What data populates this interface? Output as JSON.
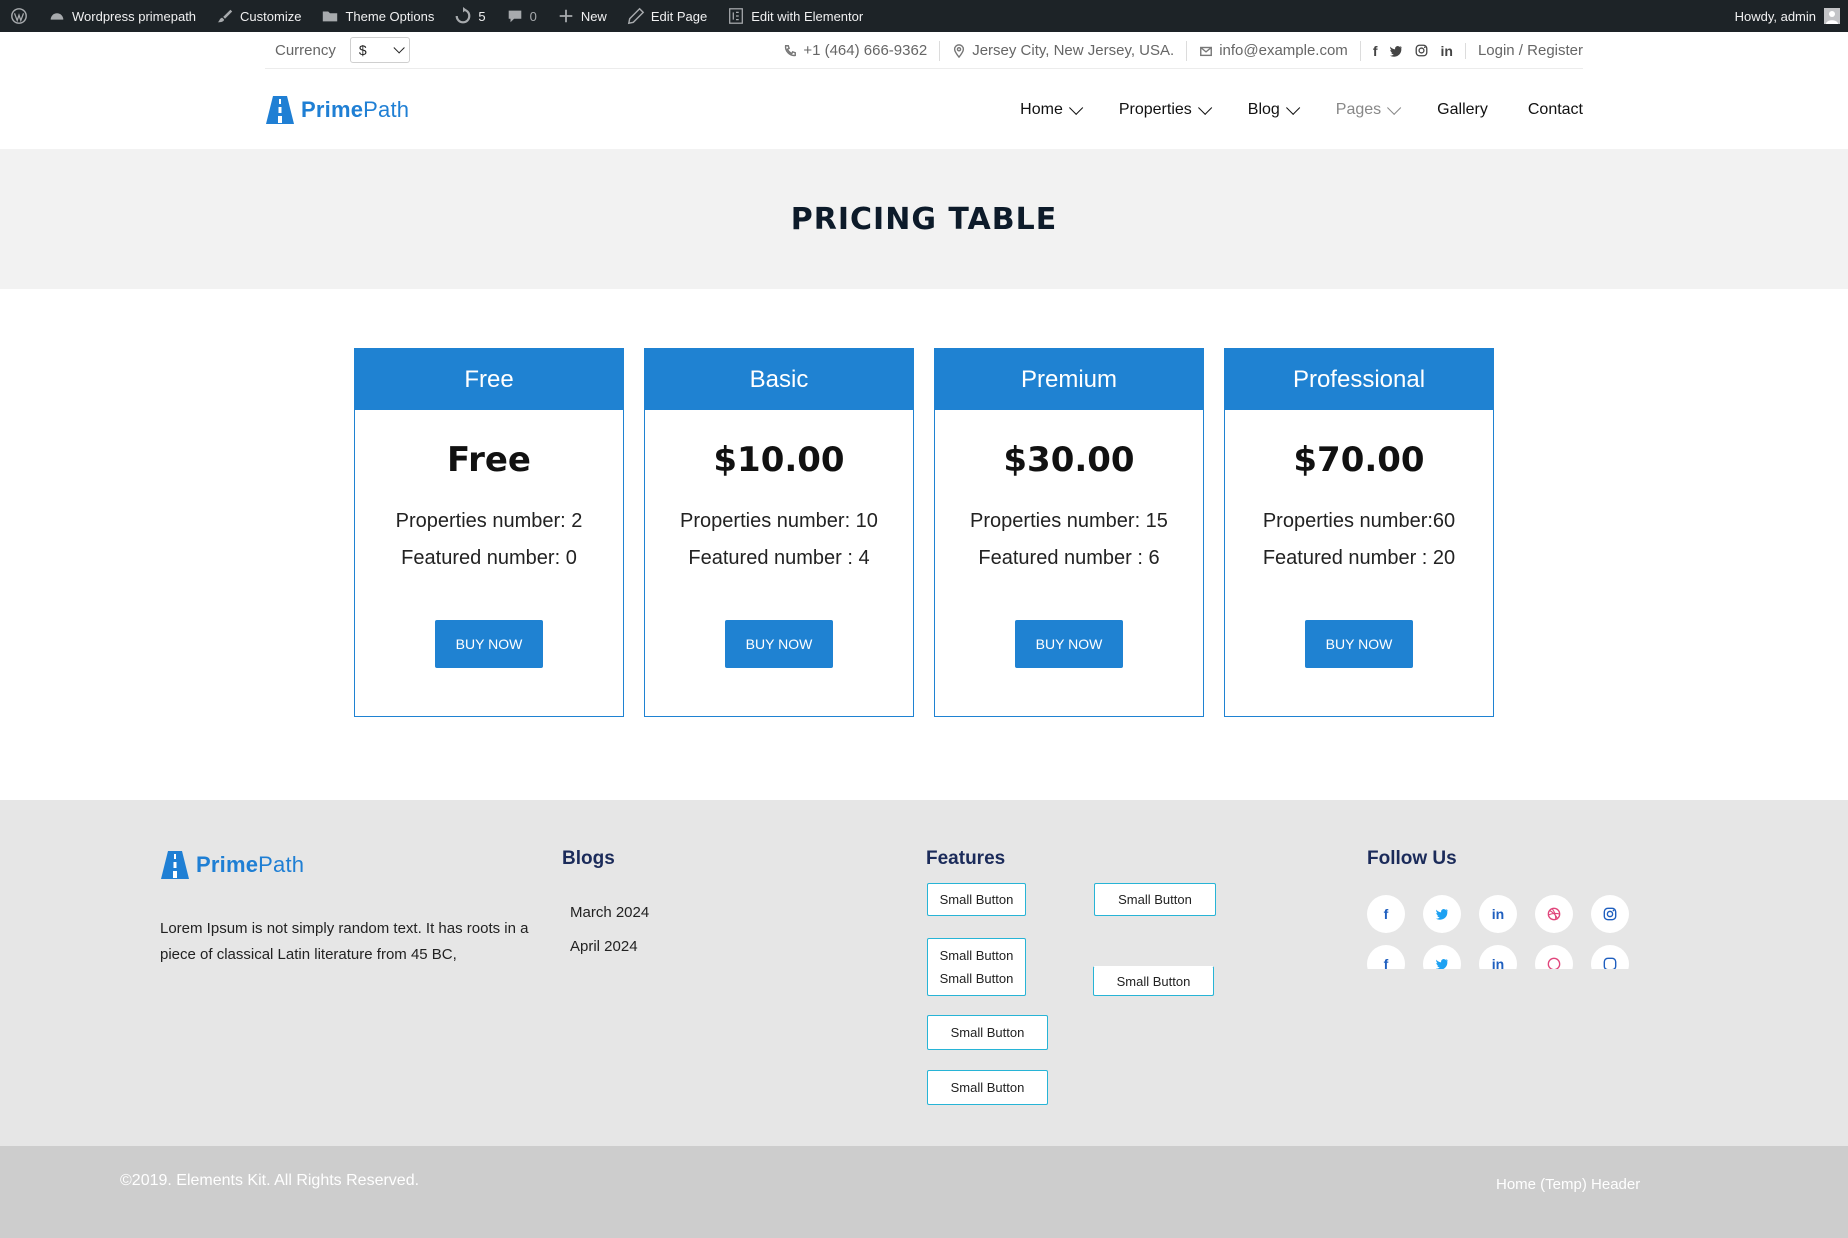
{
  "adminbar": {
    "site_name": "Wordpress primepath",
    "customize": "Customize",
    "theme_options": "Theme Options",
    "updates": "5",
    "comments": "0",
    "new": "New",
    "edit_page": "Edit Page",
    "edit_elementor": "Edit with Elementor",
    "howdy": "Howdy, admin"
  },
  "topbar": {
    "currency_label": "Currency",
    "currency_value": "$",
    "phone": "+1 (464) 666-9362",
    "location": "Jersey City, New Jersey, USA.",
    "email": "info@example.com",
    "social": [
      "f",
      "t",
      "ig",
      "in"
    ],
    "login": "Login / Register"
  },
  "header": {
    "logo_bold": "Prime",
    "logo_light": "Path",
    "nav": [
      {
        "label": "Home"
      },
      {
        "label": "Properties"
      },
      {
        "label": "Blog"
      },
      {
        "label": "Pages"
      },
      {
        "label": "Gallery"
      },
      {
        "label": "Contact"
      }
    ]
  },
  "banner": {
    "title": "PRICING TABLE"
  },
  "plans": [
    {
      "name": "Free",
      "price": "Free",
      "properties": "Properties number: 2",
      "featured": "Featured number: 0",
      "button": "BUY NOW"
    },
    {
      "name": "Basic",
      "price": "$10.00",
      "properties": "Properties number: 10",
      "featured": "Featured number : 4",
      "button": "BUY NOW"
    },
    {
      "name": "Premium",
      "price": "$30.00",
      "properties": "Properties number: 15",
      "featured": "Featured number : 6",
      "button": "BUY NOW"
    },
    {
      "name": "Professional",
      "price": "$70.00",
      "properties": "Properties number:60",
      "featured": "Featured number : 20",
      "button": "BUY NOW"
    }
  ],
  "footer": {
    "logo_bold": "Prime",
    "logo_light": "Path",
    "about": "Lorem Ipsum is not simply random text. It has roots in a piece of classical Latin literature from 45 BC,",
    "blogs_title": "Blogs",
    "blogs": [
      "March 2024",
      "April 2024"
    ],
    "features_title": "Features",
    "small_button": "Small Button",
    "follow_title": "Follow Us",
    "follow_icons": [
      "f",
      "t",
      "in",
      "db",
      "ig"
    ],
    "copyright": "©2019. Elements Kit. All Rights Reserved.",
    "bottom_link": "Home (Temp) Header"
  },
  "colors": {
    "primary": "#1f82d2",
    "adminbar": "#1d2327",
    "banner": "#f2f2f2",
    "footer": "#e6e6e6",
    "button_border": "#27b4d6"
  }
}
